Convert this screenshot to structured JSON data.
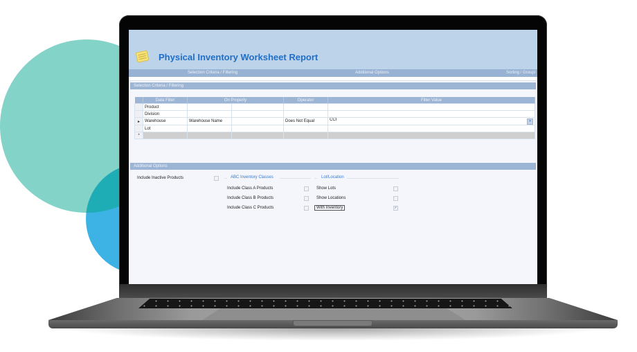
{
  "app": {
    "title": "Physical Inventory Worksheet Report",
    "icon": "report-notepad-icon"
  },
  "tabs": [
    {
      "label": "Selection Criteria / Filtering"
    },
    {
      "label": "Additional Options"
    },
    {
      "label": "Sorting / Groupi"
    }
  ],
  "selection": {
    "section_title": "Selection Criteria / Filtering",
    "columns": [
      "Data Filter",
      "On Property",
      "",
      "Operator",
      "Filter Value"
    ],
    "rows": [
      {
        "marker": "",
        "data_filter": "Product",
        "on_property": "",
        "extra": "",
        "operator": "",
        "filter_value": ""
      },
      {
        "marker": "",
        "data_filter": "Division",
        "on_property": "",
        "extra": "",
        "operator": "",
        "filter_value": ""
      },
      {
        "marker": "▸",
        "data_filter": "Warehouse",
        "on_property": "Warehouse Name",
        "extra": "",
        "operator": "Does Not Equal",
        "filter_value": "CCI"
      },
      {
        "marker": "",
        "data_filter": "Lot",
        "on_property": "",
        "extra": "",
        "operator": "",
        "filter_value": ""
      }
    ],
    "new_row_marker": "*",
    "dropdown_icon": "double-chevron-down-icon"
  },
  "additional": {
    "section_title": "Additional Options",
    "include_inactive": {
      "label": "Include Inactive Products",
      "checked": false
    },
    "abc_group": {
      "title": "ABC Inventory Classes",
      "items": [
        {
          "label": "Include Class A Products",
          "checked": false
        },
        {
          "label": "Include Class B Products",
          "checked": false
        },
        {
          "label": "Include Class C Products",
          "checked": false
        }
      ]
    },
    "lot_group": {
      "title": "Lot/Location",
      "items": [
        {
          "label": "Show Lots",
          "checked": false
        },
        {
          "label": "Show Locations",
          "checked": false
        },
        {
          "label": "With Inventory",
          "checked": true
        }
      ]
    },
    "check_glyph": "✓"
  },
  "colors": {
    "title_blue": "#1f6fc8",
    "header_bg": "#bdd3ea",
    "bar_bg": "#9db5d4",
    "teal_circle": "#84d3c8",
    "blue_circle": "#3db2e5"
  }
}
